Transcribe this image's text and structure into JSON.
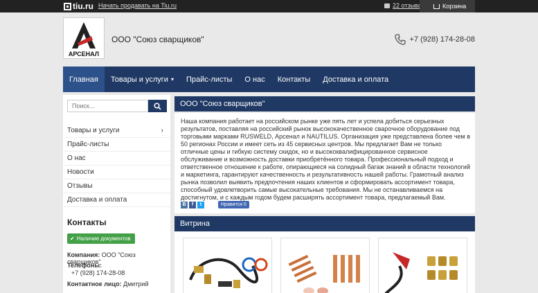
{
  "topbar": {
    "logo_text": "tiu.ru",
    "sell_link": "Начать продавать на Tiu.ru",
    "reviews": "22 отзыва",
    "cart": "Корзина"
  },
  "header": {
    "logo_text": "АРСЕНАЛ",
    "company_name": "ООО \"Союз сварщиков\"",
    "phone": "+7 (928) 174-28-08"
  },
  "nav": {
    "items": [
      "Главная",
      "Товары и услуги",
      "Прайс-листы",
      "О нас",
      "Контакты",
      "Доставка и оплата"
    ]
  },
  "sidebar": {
    "search_placeholder": "Поиск...",
    "items": [
      "Товары и услуги",
      "Прайс-листы",
      "О нас",
      "Новости",
      "Отзывы",
      "Доставка и оплата"
    ],
    "contacts_title": "Контакты",
    "docs_badge": "Наличие документов",
    "company_label": "Компания:",
    "company_value": "ООО \"Союз сварщиков\"",
    "phones_label": "Телефоны:",
    "phone_value": "+7 (928) 174-28-08",
    "contact_person_label": "Контактное лицо:",
    "contact_person_value": "Дмитрий"
  },
  "main": {
    "title": "ООО \"Союз сварщиков\"",
    "about": "Наша компания работает на российском рынке уже пять лет и успела добиться серьезных результатов, поставляя на российский рынок высококачественное сварочное оборудование под торговыми марками RUSWELD, Арсенал и NAUTILUS. Организация уже представлена более чем в 50 регионах России и имеет сеть из 45 сервисных центров. Мы предлагает Вам не только отличные цены и гибкую систему скидок, но и высококвалифицированное сервисное обслуживание и возможность доставки приобретённого товара. Профессиональный подход и ответственное отношение к работе, опирающиеся на солидный багаж знаний в области технологий и маркетинга, гарантируют качественность и результативность нашей работы. Грамотный анализ рынка позволил выявить предпочтения наших клиентов и сформировать ассортимент товара, способный удовлетворить самые высокательные требования. Мы не останавливаемся на достигнутом, и с каждым годом будем расширять ассортимент товара, предлагаемый Вам.",
    "like_label": "Нравится 0",
    "showcase_title": "Витрина"
  },
  "colors": {
    "nav_bg": "#1f3964",
    "nav_active": "#2d518a",
    "badge_green": "#43a047",
    "logo_red": "#c62828"
  }
}
